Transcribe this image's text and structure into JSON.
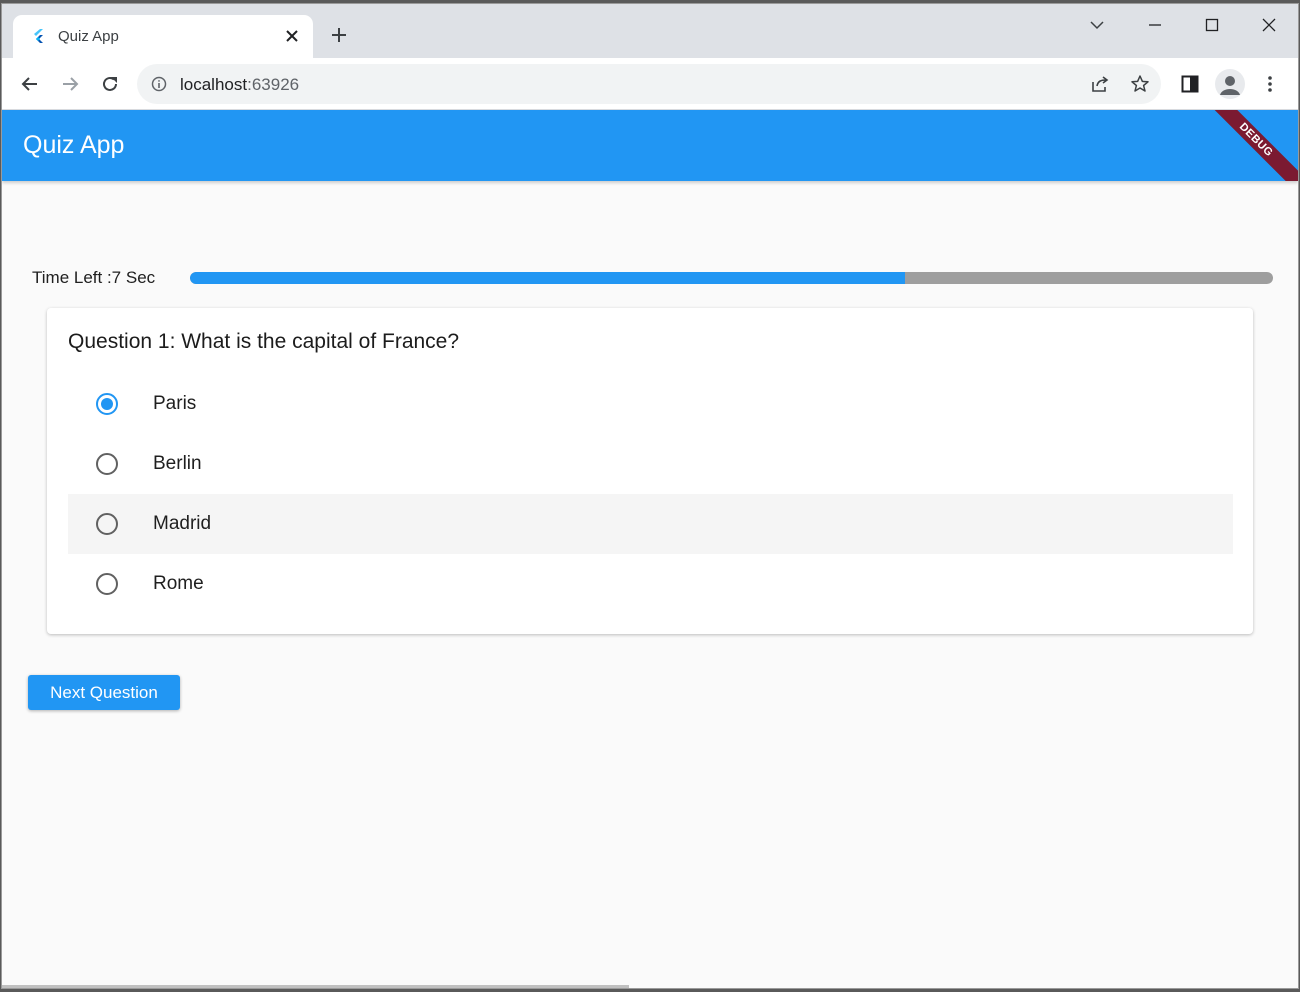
{
  "browser": {
    "tab_title": "Quiz App",
    "url_host": "localhost",
    "url_port": ":63926"
  },
  "app": {
    "title": "Quiz App",
    "debug_label": "DEBUG",
    "accent_color": "#2196f3",
    "timer_label": "Time Left :7 Sec",
    "timer_progress": 0.66,
    "question": "Question 1: What is the capital of France?",
    "options": [
      {
        "label": "Paris",
        "selected": true
      },
      {
        "label": "Berlin",
        "selected": false
      },
      {
        "label": "Madrid",
        "selected": false
      },
      {
        "label": "Rome",
        "selected": false
      }
    ],
    "next_button": "Next Question"
  }
}
